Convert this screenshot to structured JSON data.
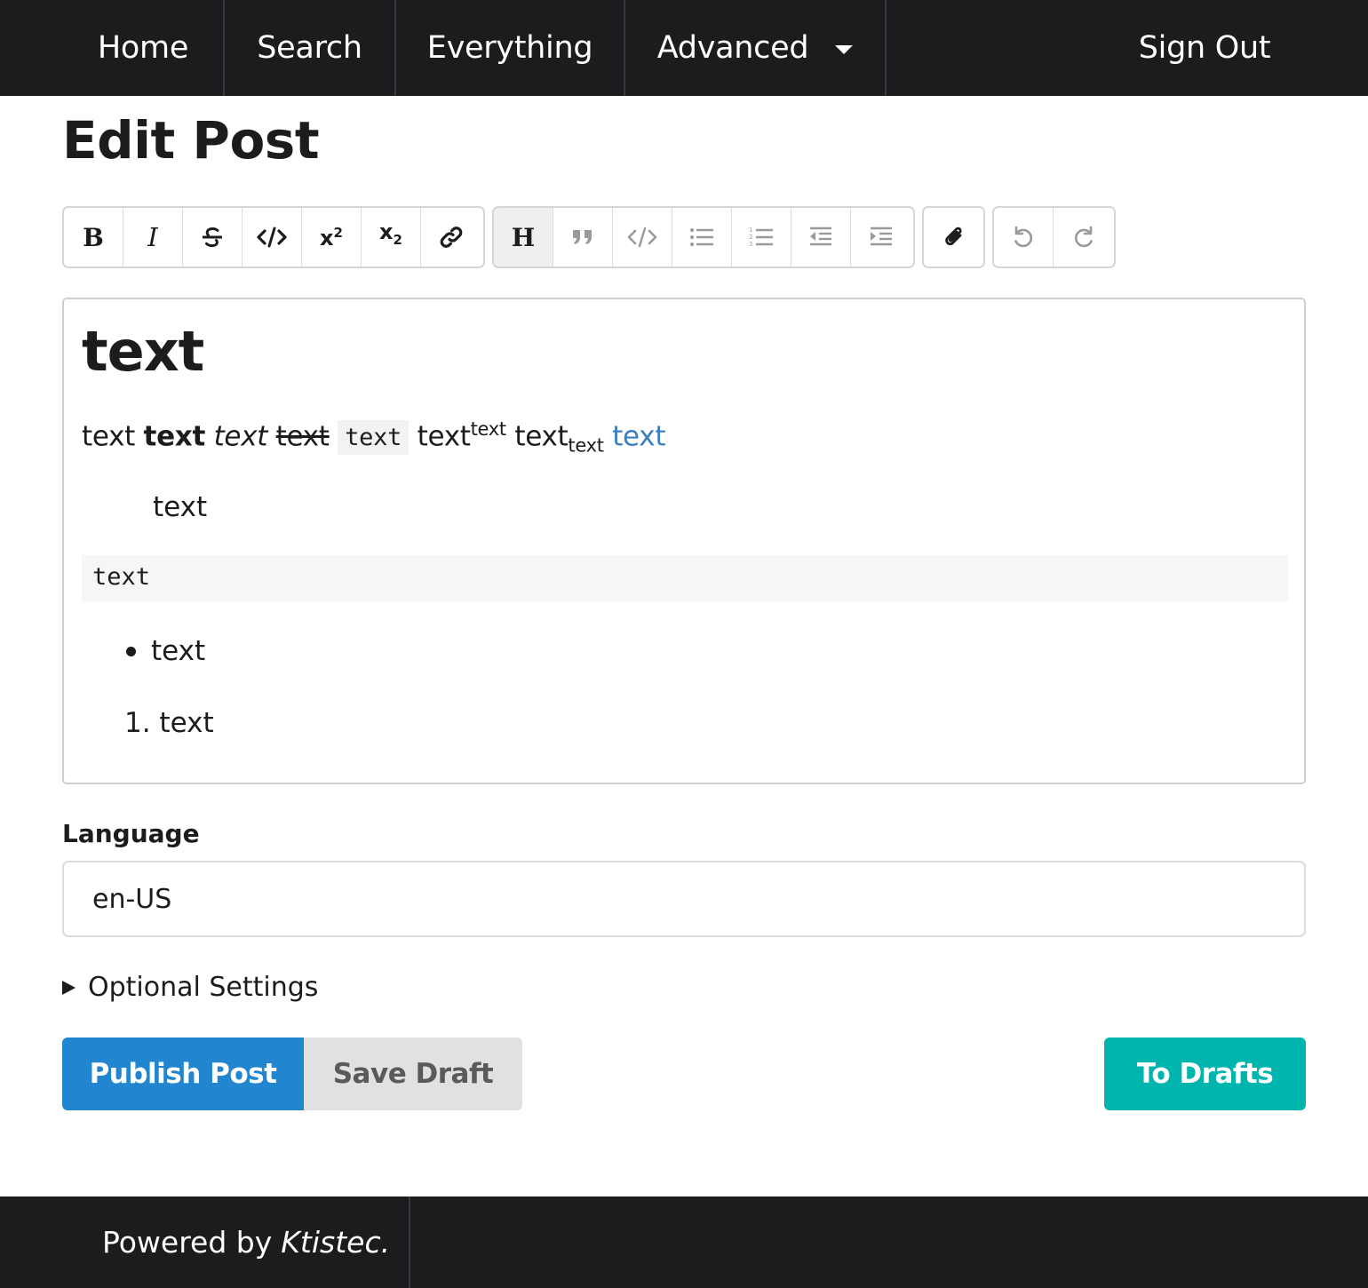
{
  "nav": {
    "home": "Home",
    "search": "Search",
    "everything": "Everything",
    "advanced": "Advanced",
    "sign_out": "Sign Out"
  },
  "page": {
    "title": "Edit Post"
  },
  "toolbar": {
    "text_group": [
      "bold-icon",
      "italic-icon",
      "strikethrough-icon",
      "code-icon",
      "superscript-icon",
      "subscript-icon",
      "link-icon"
    ],
    "block_group": [
      "heading-icon",
      "quote-icon",
      "code-block-icon",
      "bullet-list-icon",
      "numbered-list-icon",
      "outdent-icon",
      "indent-icon"
    ],
    "file_group": [
      "attach-icon"
    ],
    "history_group": [
      "undo-icon",
      "redo-icon"
    ],
    "labels": {
      "bold": "B",
      "italic": "I",
      "heading": "H"
    }
  },
  "editor": {
    "heading": "text",
    "line": {
      "plain": "text",
      "bold": "text",
      "italic": "text",
      "strike": "text",
      "code": "text",
      "sup_base": "text",
      "sup": "text",
      "sub_base": "text",
      "sub": "text",
      "link": "text"
    },
    "quote": "text",
    "code_block": "text",
    "bullet_item": "text",
    "numbered_item": "1. text"
  },
  "language": {
    "label": "Language",
    "value": "en-US"
  },
  "optional_settings": "Optional Settings",
  "buttons": {
    "publish": "Publish Post",
    "save_draft": "Save Draft",
    "to_drafts": "To Drafts"
  },
  "footer": {
    "prefix": "Powered by",
    "brand": "Ktistec."
  },
  "colors": {
    "nav_bg": "#1b1c1d",
    "publish": "#2185d0",
    "save_draft": "#e0e1e2",
    "to_drafts": "#00b5ad",
    "link": "#3a7fc4"
  }
}
